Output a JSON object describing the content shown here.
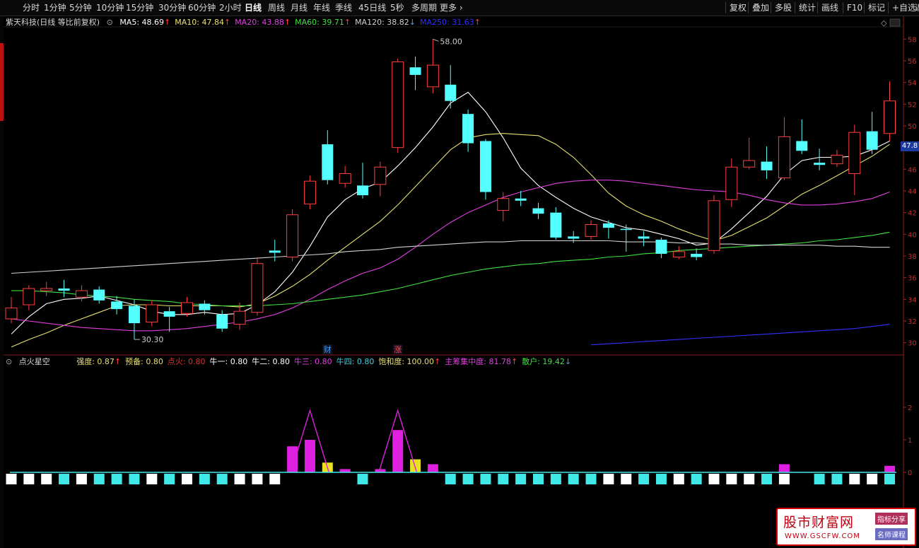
{
  "toolbar": {
    "periods": [
      "分时",
      "1分钟",
      "5分钟",
      "10分钟",
      "15分钟",
      "30分钟",
      "60分钟",
      "2小时",
      "日线",
      "周线",
      "月线",
      "年线",
      "季线",
      "45日线",
      "5秒",
      "多周期",
      "更多"
    ],
    "active": "日线",
    "right": [
      "复权",
      "叠加",
      "多股",
      "统计",
      "画线",
      "F10",
      "标记",
      "+自选",
      "返"
    ]
  },
  "main_info": {
    "title": "紫天科技(日线 等比前复权)",
    "ma": [
      {
        "text": "MA5: 48.69",
        "arrow": "↑",
        "color": "#ffffff"
      },
      {
        "text": "MA10: 47.84",
        "arrow": "↑",
        "color": "#e8e070"
      },
      {
        "text": "MA20: 43.88",
        "arrow": "↑",
        "color": "#e040e0"
      },
      {
        "text": "MA60: 39.71",
        "arrow": "↑",
        "color": "#40e040"
      },
      {
        "text": "MA120: 38.82",
        "arrow": "↓",
        "color": "#d0d0d0"
      },
      {
        "text": "MA250: 31.63",
        "arrow": "↑",
        "color": "#3030ff"
      }
    ]
  },
  "indicator": {
    "title": "点火星空",
    "items": [
      {
        "text": "强度: 0.87",
        "arrow": "↑",
        "color": "#e8e070"
      },
      {
        "text": "预备: 0.80",
        "arrow": "",
        "color": "#e8e070"
      },
      {
        "text": "点火: 0.80",
        "arrow": "",
        "color": "#e03030"
      },
      {
        "text": "牛一: 0.80",
        "arrow": "",
        "color": "#ffffff"
      },
      {
        "text": "牛二: 0.80",
        "arrow": "",
        "color": "#ffffff"
      },
      {
        "text": "牛三: 0.80",
        "arrow": "",
        "color": "#e040e0"
      },
      {
        "text": "牛四: 0.80",
        "arrow": "",
        "color": "#40d0e0"
      },
      {
        "text": "饱和度: 100.00",
        "arrow": "↑",
        "color": "#e8e070"
      },
      {
        "text": "主筹集中度: 81.78",
        "arrow": "↑",
        "color": "#e040e0"
      },
      {
        "text": "散户: 19.42",
        "arrow": "↓",
        "color": "#40e040"
      }
    ]
  },
  "current_price_tag": "47.8",
  "watermark": {
    "main": "股市财富网",
    "url": "WWW.GSCFW.COM",
    "tag1": "指标分享",
    "tag2": "名师课程"
  },
  "chart_data": [
    {
      "type": "candlestick",
      "title": "紫天科技(日线 等比前复权)",
      "y_ticks": [
        58,
        56,
        54,
        52,
        50,
        48,
        46,
        44,
        42,
        40,
        38,
        36,
        34,
        32,
        30
      ],
      "ylim": [
        29,
        59
      ],
      "annotations": [
        {
          "text": "58.00",
          "candle": 24
        },
        {
          "text": "30.30",
          "candle": 7
        }
      ],
      "event_markers": [
        {
          "text": "财",
          "candle": 18,
          "color": "#40a0ff"
        },
        {
          "text": "涨",
          "candle": 22,
          "color": "#ff5050"
        }
      ],
      "candles": [
        {
          "o": 32.2,
          "c": 33.2,
          "h": 34.2,
          "l": 31.8
        },
        {
          "o": 33.5,
          "c": 35.0,
          "h": 35.3,
          "l": 33.0
        },
        {
          "o": 34.8,
          "c": 35.0,
          "h": 35.6,
          "l": 34.3
        },
        {
          "o": 35.0,
          "c": 34.8,
          "h": 35.8,
          "l": 34.2
        },
        {
          "o": 34.2,
          "c": 34.8,
          "h": 35.3,
          "l": 33.8
        },
        {
          "o": 34.9,
          "c": 33.9,
          "h": 35.2,
          "l": 33.6
        },
        {
          "o": 33.8,
          "c": 33.1,
          "h": 34.3,
          "l": 32.6
        },
        {
          "o": 33.4,
          "c": 31.8,
          "h": 34.0,
          "l": 30.3
        },
        {
          "o": 31.9,
          "c": 33.5,
          "h": 33.9,
          "l": 31.5
        },
        {
          "o": 32.9,
          "c": 32.4,
          "h": 33.3,
          "l": 31.0
        },
        {
          "o": 32.7,
          "c": 33.7,
          "h": 34.2,
          "l": 32.4
        },
        {
          "o": 33.6,
          "c": 33.0,
          "h": 33.9,
          "l": 32.6
        },
        {
          "o": 32.6,
          "c": 31.3,
          "h": 33.0,
          "l": 31.0
        },
        {
          "o": 31.7,
          "c": 32.9,
          "h": 33.7,
          "l": 31.2
        },
        {
          "o": 32.8,
          "c": 37.3,
          "h": 37.9,
          "l": 32.5
        },
        {
          "o": 38.5,
          "c": 38.3,
          "h": 39.5,
          "l": 37.5
        },
        {
          "o": 37.9,
          "c": 41.8,
          "h": 42.3,
          "l": 37.5
        },
        {
          "o": 42.8,
          "c": 44.9,
          "h": 45.4,
          "l": 42.3
        },
        {
          "o": 48.3,
          "c": 45.0,
          "h": 49.6,
          "l": 44.6
        },
        {
          "o": 44.7,
          "c": 45.6,
          "h": 46.3,
          "l": 44.3
        },
        {
          "o": 44.5,
          "c": 43.6,
          "h": 46.6,
          "l": 43.3
        },
        {
          "o": 44.6,
          "c": 46.2,
          "h": 46.7,
          "l": 43.5
        },
        {
          "o": 48.0,
          "c": 55.9,
          "h": 56.2,
          "l": 47.5
        },
        {
          "o": 55.4,
          "c": 54.7,
          "h": 56.4,
          "l": 53.3
        },
        {
          "o": 53.6,
          "c": 55.6,
          "h": 58.0,
          "l": 53.0
        },
        {
          "o": 53.8,
          "c": 52.3,
          "h": 55.6,
          "l": 51.6
        },
        {
          "o": 51.1,
          "c": 48.4,
          "h": 51.5,
          "l": 47.6
        },
        {
          "o": 48.6,
          "c": 43.9,
          "h": 48.8,
          "l": 43.2
        },
        {
          "o": 42.2,
          "c": 43.3,
          "h": 43.9,
          "l": 41.2
        },
        {
          "o": 43.3,
          "c": 43.1,
          "h": 44.0,
          "l": 42.6
        },
        {
          "o": 42.4,
          "c": 41.9,
          "h": 42.9,
          "l": 41.4
        },
        {
          "o": 42.0,
          "c": 39.7,
          "h": 42.5,
          "l": 39.5
        },
        {
          "o": 39.8,
          "c": 39.6,
          "h": 40.3,
          "l": 39.2
        },
        {
          "o": 39.8,
          "c": 40.9,
          "h": 41.3,
          "l": 39.5
        },
        {
          "o": 41.0,
          "c": 40.6,
          "h": 41.3,
          "l": 39.6
        },
        {
          "o": 40.5,
          "c": 40.4,
          "h": 40.9,
          "l": 38.4
        },
        {
          "o": 39.8,
          "c": 39.6,
          "h": 40.3,
          "l": 38.9
        },
        {
          "o": 39.5,
          "c": 38.2,
          "h": 39.7,
          "l": 37.8
        },
        {
          "o": 37.9,
          "c": 38.4,
          "h": 38.9,
          "l": 37.7
        },
        {
          "o": 38.2,
          "c": 37.9,
          "h": 38.7,
          "l": 37.6
        },
        {
          "o": 38.5,
          "c": 43.1,
          "h": 43.6,
          "l": 38.2
        },
        {
          "o": 43.2,
          "c": 46.2,
          "h": 47.0,
          "l": 42.5
        },
        {
          "o": 46.2,
          "c": 46.8,
          "h": 48.9,
          "l": 46.0
        },
        {
          "o": 46.7,
          "c": 45.9,
          "h": 48.1,
          "l": 45.1
        },
        {
          "o": 45.2,
          "c": 49.0,
          "h": 50.8,
          "l": 45.0
        },
        {
          "o": 48.6,
          "c": 47.7,
          "h": 50.6,
          "l": 47.4
        },
        {
          "o": 46.6,
          "c": 46.4,
          "h": 47.9,
          "l": 45.9
        },
        {
          "o": 46.5,
          "c": 47.3,
          "h": 47.8,
          "l": 46.2
        },
        {
          "o": 45.6,
          "c": 49.4,
          "h": 50.1,
          "l": 43.6
        },
        {
          "o": 49.5,
          "c": 47.8,
          "h": 51.3,
          "l": 47.4
        },
        {
          "o": 49.3,
          "c": 52.3,
          "h": 54.1,
          "l": 48.6
        }
      ],
      "series": [
        {
          "name": "MA5",
          "color": "#ffffff",
          "values": [
            30.8,
            32.4,
            33.6,
            34.0,
            34.1,
            34.3,
            33.9,
            33.5,
            32.9,
            32.6,
            32.6,
            32.8,
            32.6,
            32.7,
            33.5,
            34.7,
            36.5,
            38.9,
            41.6,
            43.2,
            44.2,
            44.8,
            46.3,
            48.0,
            49.9,
            52.1,
            53.1,
            51.3,
            48.9,
            46.1,
            44.5,
            43.4,
            42.4,
            41.6,
            41.1,
            40.6,
            40.4,
            40.0,
            39.6,
            39.0,
            39.2,
            40.5,
            42.0,
            43.5,
            45.5,
            46.8,
            47.1,
            47.1,
            47.2,
            47.8,
            48.6
          ]
        },
        {
          "name": "MA10",
          "color": "#e8e070",
          "values": [
            29.6,
            30.3,
            30.9,
            31.6,
            32.2,
            32.8,
            33.4,
            33.5,
            33.5,
            33.4,
            33.4,
            33.4,
            33.4,
            33.3,
            33.6,
            34.3,
            35.2,
            36.3,
            37.6,
            38.8,
            40.0,
            41.2,
            42.7,
            44.4,
            46.1,
            47.8,
            48.9,
            49.2,
            49.3,
            49.2,
            49.1,
            48.3,
            47.1,
            45.5,
            43.8,
            42.6,
            41.8,
            41.2,
            40.5,
            39.9,
            39.4,
            39.9,
            40.7,
            41.5,
            42.6,
            43.7,
            44.5,
            45.4,
            46.3,
            47.2,
            48.3
          ]
        },
        {
          "name": "MA20",
          "color": "#e040e0",
          "values": [
            32.2,
            32.0,
            31.8,
            31.6,
            31.4,
            31.3,
            31.2,
            31.1,
            31.1,
            31.2,
            31.3,
            31.5,
            31.7,
            31.9,
            32.2,
            32.6,
            33.2,
            34.0,
            34.9,
            35.7,
            36.4,
            36.9,
            37.7,
            38.8,
            40.0,
            41.1,
            42.0,
            42.7,
            43.4,
            43.9,
            44.3,
            44.7,
            44.9,
            45.0,
            45.0,
            44.9,
            44.7,
            44.5,
            44.3,
            44.1,
            44.0,
            43.9,
            43.6,
            43.2,
            42.9,
            42.7,
            42.7,
            42.8,
            43.0,
            43.3,
            43.9
          ]
        },
        {
          "name": "MA60",
          "color": "#40e040",
          "values": [
            34.8,
            34.8,
            34.7,
            34.6,
            34.4,
            34.3,
            34.2,
            34.0,
            33.9,
            33.8,
            33.6,
            33.5,
            33.4,
            33.4,
            33.4,
            33.5,
            33.6,
            33.8,
            34.0,
            34.2,
            34.4,
            34.7,
            35.0,
            35.4,
            35.8,
            36.2,
            36.5,
            36.8,
            37.0,
            37.2,
            37.3,
            37.5,
            37.6,
            37.7,
            37.9,
            38.0,
            38.2,
            38.3,
            38.5,
            38.6,
            38.7,
            38.8,
            38.9,
            39.0,
            39.1,
            39.2,
            39.4,
            39.5,
            39.7,
            39.9,
            40.2
          ]
        },
        {
          "name": "MA120",
          "color": "#d0d0d0",
          "values": [
            36.4,
            36.5,
            36.6,
            36.7,
            36.8,
            36.9,
            37.0,
            37.1,
            37.2,
            37.3,
            37.4,
            37.5,
            37.6,
            37.7,
            37.8,
            37.9,
            38.0,
            38.1,
            38.2,
            38.4,
            38.5,
            38.6,
            38.8,
            38.9,
            39.0,
            39.1,
            39.2,
            39.3,
            39.3,
            39.4,
            39.4,
            39.4,
            39.4,
            39.4,
            39.4,
            39.3,
            39.3,
            39.3,
            39.2,
            39.2,
            39.1,
            39.1,
            39.0,
            39.0,
            39.0,
            39.0,
            39.0,
            38.9,
            38.9,
            38.8,
            38.8
          ]
        },
        {
          "name": "MA250",
          "color": "#3030ff",
          "values": [
            null,
            null,
            null,
            null,
            null,
            null,
            null,
            null,
            null,
            null,
            null,
            null,
            null,
            null,
            null,
            null,
            null,
            null,
            null,
            null,
            null,
            null,
            null,
            null,
            null,
            null,
            null,
            null,
            null,
            null,
            null,
            null,
            null,
            29.8,
            29.9,
            30.0,
            30.1,
            30.2,
            30.3,
            30.4,
            30.5,
            30.6,
            30.7,
            30.8,
            30.9,
            31.0,
            31.1,
            31.2,
            31.3,
            31.5,
            31.7
          ]
        }
      ]
    },
    {
      "type": "bar",
      "title": "点火星空",
      "y_ticks": [
        2,
        1,
        0
      ],
      "ylim": [
        -2,
        3
      ],
      "baseline": 0,
      "bottom_blocks": [
        "white",
        "white",
        "white",
        "cyan",
        "white",
        "cyan",
        "cyan",
        "cyan",
        "white",
        "cyan",
        "white",
        "cyan",
        "cyan",
        "white",
        "white",
        "white",
        "none",
        "none",
        "none",
        "none",
        "cyan",
        "none",
        "none",
        "none",
        "none",
        "cyan",
        "cyan",
        "cyan",
        "cyan",
        "cyan",
        "cyan",
        "cyan",
        "cyan",
        "cyan",
        "white",
        "white",
        "cyan",
        "cyan",
        "white",
        "cyan",
        "white",
        "white",
        "white",
        "cyan",
        "white",
        "none",
        "cyan",
        "cyan",
        "white",
        "white",
        "cyan"
      ],
      "top_bars": [
        {
          "candle": 16,
          "value": 0.8,
          "color": "#e020e0"
        },
        {
          "candle": 17,
          "value": 1.0,
          "color": "#e020e0"
        },
        {
          "candle": 18,
          "value": 0.3,
          "color": "#e8e020"
        },
        {
          "candle": 19,
          "value": 0.1,
          "color": "#e020e0"
        },
        {
          "candle": 21,
          "value": 0.1,
          "color": "#e020e0"
        },
        {
          "candle": 22,
          "value": 1.3,
          "color": "#e020e0"
        },
        {
          "candle": 23,
          "value": 0.4,
          "color": "#e8e020"
        },
        {
          "candle": 24,
          "value": 0.25,
          "color": "#e020e0"
        },
        {
          "candle": 44,
          "value": 0.25,
          "color": "#e020e0"
        },
        {
          "candle": 50,
          "value": 0.2,
          "color": "#e020e0"
        }
      ],
      "peaks": [
        {
          "from": 16,
          "to": 18,
          "peak": 1.9
        },
        {
          "from": 21,
          "to": 23,
          "peak": 1.9
        }
      ]
    }
  ]
}
